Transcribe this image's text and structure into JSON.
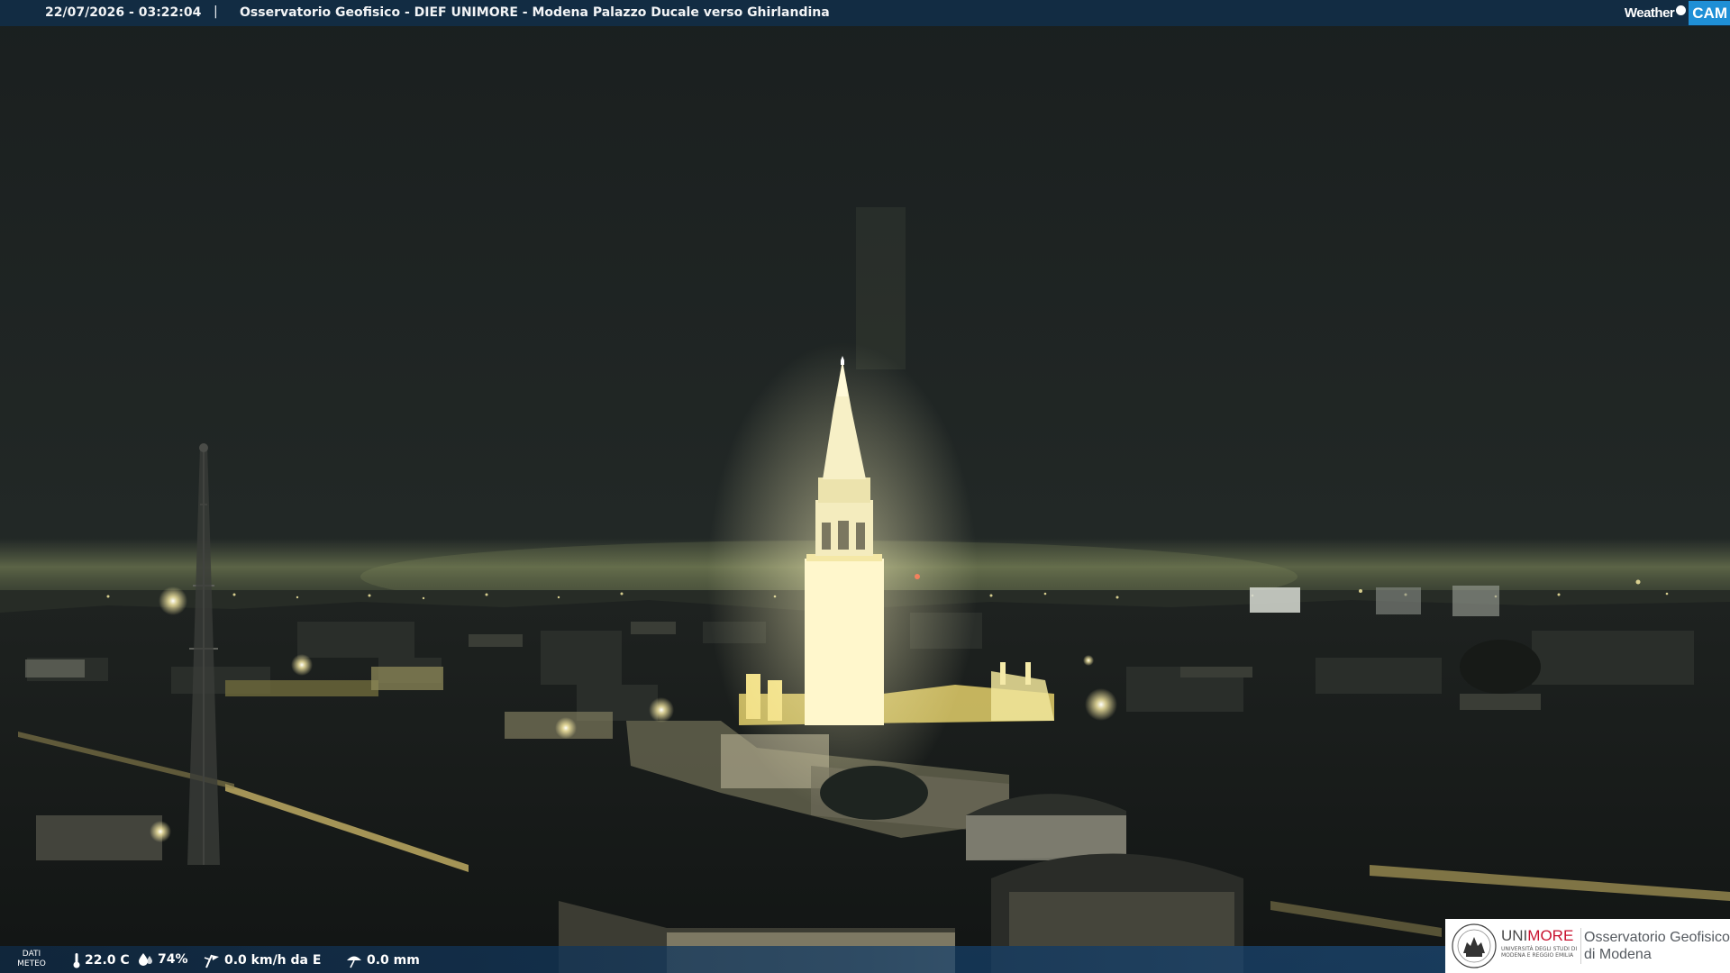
{
  "overlay": {
    "timestamp": "22/07/2026 - 03:22:04",
    "separator": "|",
    "title": "Osservatorio Geofisico - DIEF UNIMORE - Modena Palazzo Ducale verso Ghirlandina"
  },
  "brand": {
    "weather": "Weather",
    "cam": "CAM"
  },
  "weather_bar": {
    "label_line1": "DATI",
    "label_line2": "METEO",
    "temperature": "22.0 C",
    "humidity": "74%",
    "wind": "0.0 km/h da E",
    "rain": "0.0 mm",
    "icons": [
      "thermometer-icon",
      "humidity-drop-icon",
      "wind-icon",
      "rain-umbrella-icon"
    ]
  },
  "logo": {
    "uni_part1": "UNI",
    "uni_part2": "MORE",
    "uni_subtitle": "UNIVERSITÀ DEGLI STUDI DI MODENA E REGGIO EMILIA",
    "observatory_line1": "Osservatorio Geofisico",
    "observatory_line2": "di Modena"
  },
  "colors": {
    "sky": "#1e2322",
    "haze": "#6b7450",
    "tower_light": "#fff6c8",
    "warm_light": "#e8cf66",
    "overlay_bar": "#122d46",
    "unimore_red": "#c8102e",
    "weathercam_blue": "#1f8fd6"
  }
}
